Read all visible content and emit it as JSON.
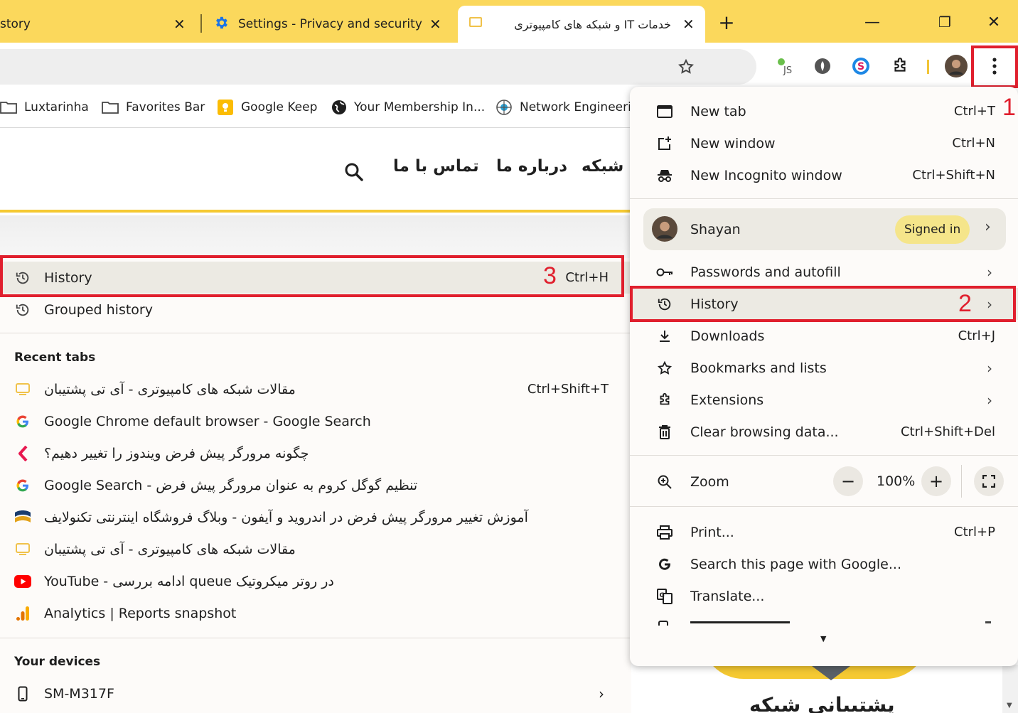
{
  "tabs": [
    {
      "title": "story",
      "close": "✕"
    },
    {
      "title": "Settings - Privacy and security",
      "close": "✕"
    },
    {
      "title": "خدمات IT و شبکه های کامپیوتری",
      "close": "✕"
    }
  ],
  "new_tab_symbol": "+",
  "window_controls": {
    "minimize": "—",
    "restore": "❐",
    "close": "✕"
  },
  "bookmarks": [
    {
      "label": "Luxtarinha",
      "icon": "folder-icon"
    },
    {
      "label": "Favorites Bar",
      "icon": "folder-icon"
    },
    {
      "label": "Google Keep",
      "icon": "keep-icon"
    },
    {
      "label": "Your Membership In...",
      "icon": "globe-icon"
    },
    {
      "label": "Network Engineerin",
      "icon": "network-icon"
    }
  ],
  "site_nav": {
    "contact": "تماس با ما",
    "about": "درباره ما",
    "network": "ت شبکه"
  },
  "submenu": {
    "history": {
      "label": "History",
      "shortcut": "Ctrl+H"
    },
    "grouped_history": "Grouped history",
    "recent_tabs_title": "Recent tabs",
    "recent_tabs_shortcut": "Ctrl+Shift+T",
    "recent_tabs": [
      {
        "label": "مقالات شبکه های کامپیوتری - آی تی پشتیبان",
        "icon": "itsite-icon"
      },
      {
        "label": "Google Chrome default browser - Google Search",
        "icon": "google-icon"
      },
      {
        "label": "چگونه مرورگر پیش فرض ویندوز را تغییر دهیم؟",
        "icon": "bracket-icon"
      },
      {
        "label": "Google Search - تنظیم گوگل کروم به عنوان مرورگر پیش فرض",
        "icon": "google-icon"
      },
      {
        "label": "آموزش تغییر مرورگر پیش فرض در اندروید و آیفون - وبلاگ فروشگاه اینترنتی تکنولایف",
        "icon": "technolife-icon"
      },
      {
        "label": "مقالات شبکه های کامپیوتری - آی تی پشتیبان",
        "icon": "itsite-icon"
      },
      {
        "label": "YouTube - ادامه بررسی queue در روتر میکروتیک",
        "icon": "youtube-icon"
      },
      {
        "label": "Analytics | Reports snapshot",
        "icon": "analytics-icon"
      }
    ],
    "devices_title": "Your devices",
    "device": "SM-M317F"
  },
  "menu": {
    "new_tab": {
      "label": "New tab",
      "shortcut": "Ctrl+T"
    },
    "new_window": {
      "label": "New window",
      "shortcut": "Ctrl+N"
    },
    "incognito": {
      "label": "New Incognito window",
      "shortcut": "Ctrl+Shift+N"
    },
    "profile": {
      "name": "Shayan",
      "status": "Signed in"
    },
    "passwords": "Passwords and autofill",
    "history": "History",
    "downloads": {
      "label": "Downloads",
      "shortcut": "Ctrl+J"
    },
    "bookmarks": "Bookmarks and lists",
    "extensions": "Extensions",
    "clear": {
      "label": "Clear browsing data...",
      "shortcut": "Ctrl+Shift+Del"
    },
    "zoom": {
      "label": "Zoom",
      "value": "100%",
      "minus": "−",
      "plus": "+"
    },
    "print": {
      "label": "Print...",
      "shortcut": "Ctrl+P"
    },
    "search_google": "Search this page with Google...",
    "translate": "Translate..."
  },
  "page_footer_text": "پشتیبانی شبکه",
  "annotations": {
    "step1": "1",
    "step2": "2",
    "step3": "3"
  },
  "colors": {
    "tabstrip": "#fbd85c",
    "highlight": "#e01f2d",
    "accent": "#f5c932"
  }
}
